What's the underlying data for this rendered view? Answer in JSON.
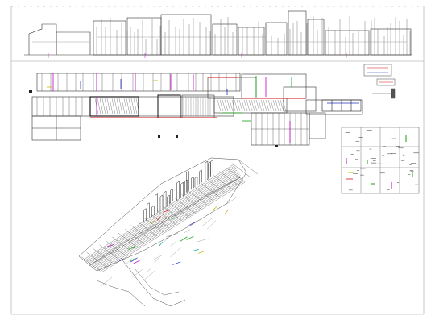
{
  "drawing": {
    "sheet_frame_color": "#9a9a9a",
    "line_colors": {
      "structure": "#222222",
      "magenta": "#c000c0",
      "red": "#d01010",
      "green": "#10a010",
      "blue": "#2030c0",
      "yellow": "#c8b400",
      "cyan": "#0aa0a0",
      "grey": "#7a7a7a"
    },
    "views": [
      {
        "id": "elevation",
        "kind": "front elevation"
      },
      {
        "id": "plan",
        "kind": "floor plan"
      },
      {
        "id": "section-detail",
        "kind": "section"
      },
      {
        "id": "legend-panel",
        "kind": "detail grid"
      },
      {
        "id": "legend-symbols",
        "kind": "symbol legend"
      },
      {
        "id": "axonometric",
        "kind": "3D wireframe"
      }
    ]
  }
}
